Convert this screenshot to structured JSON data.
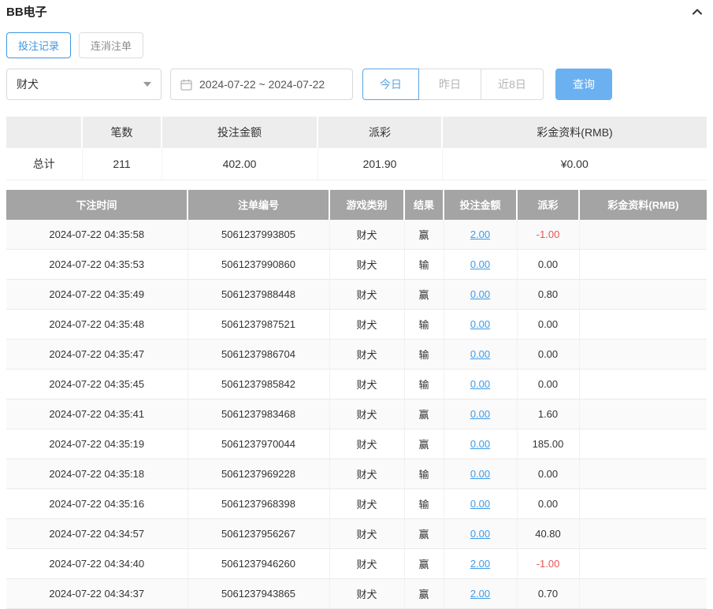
{
  "colors": {
    "accent_blue": "#3d96e0",
    "link_blue": "#3d9ae8",
    "button_blue": "#6bb1f2",
    "negative_red": "#e65454",
    "table_header_gray": "#a4a4a4"
  },
  "header": {
    "title": "BB电子"
  },
  "tabs": [
    {
      "label": "投注记录",
      "active": true
    },
    {
      "label": "连消注单",
      "active": false
    }
  ],
  "filters": {
    "game_select_value": "财犬",
    "date_range_value": "2024-07-22 ~ 2024-07-22",
    "quick_buttons": [
      {
        "label": "今日",
        "active": true
      },
      {
        "label": "昨日",
        "active": false
      },
      {
        "label": "近8日",
        "active": false
      }
    ],
    "search_label": "查询"
  },
  "summary": {
    "headers": [
      "",
      "笔数",
      "投注金额",
      "派彩",
      "彩金资料(RMB)"
    ],
    "row": {
      "label": "总计",
      "count": "211",
      "bet_amount": "402.00",
      "payout": "201.90",
      "bonus": "¥0.00"
    }
  },
  "table": {
    "headers": [
      "下注时间",
      "注单编号",
      "游戏类别",
      "结果",
      "投注金额",
      "派彩",
      "彩金资料(RMB)"
    ],
    "rows": [
      {
        "time": "2024-07-22 04:35:58",
        "order": "5061237993805",
        "game": "财犬",
        "result": "赢",
        "amount": "2.00",
        "payout": "-1.00",
        "bonus": ""
      },
      {
        "time": "2024-07-22 04:35:53",
        "order": "5061237990860",
        "game": "财犬",
        "result": "输",
        "amount": "0.00",
        "payout": "0.00",
        "bonus": ""
      },
      {
        "time": "2024-07-22 04:35:49",
        "order": "5061237988448",
        "game": "财犬",
        "result": "赢",
        "amount": "0.00",
        "payout": "0.80",
        "bonus": ""
      },
      {
        "time": "2024-07-22 04:35:48",
        "order": "5061237987521",
        "game": "财犬",
        "result": "输",
        "amount": "0.00",
        "payout": "0.00",
        "bonus": ""
      },
      {
        "time": "2024-07-22 04:35:47",
        "order": "5061237986704",
        "game": "财犬",
        "result": "输",
        "amount": "0.00",
        "payout": "0.00",
        "bonus": ""
      },
      {
        "time": "2024-07-22 04:35:45",
        "order": "5061237985842",
        "game": "财犬",
        "result": "输",
        "amount": "0.00",
        "payout": "0.00",
        "bonus": ""
      },
      {
        "time": "2024-07-22 04:35:41",
        "order": "5061237983468",
        "game": "财犬",
        "result": "赢",
        "amount": "0.00",
        "payout": "1.60",
        "bonus": ""
      },
      {
        "time": "2024-07-22 04:35:19",
        "order": "5061237970044",
        "game": "财犬",
        "result": "赢",
        "amount": "0.00",
        "payout": "185.00",
        "bonus": ""
      },
      {
        "time": "2024-07-22 04:35:18",
        "order": "5061237969228",
        "game": "财犬",
        "result": "输",
        "amount": "0.00",
        "payout": "0.00",
        "bonus": ""
      },
      {
        "time": "2024-07-22 04:35:16",
        "order": "5061237968398",
        "game": "财犬",
        "result": "输",
        "amount": "0.00",
        "payout": "0.00",
        "bonus": ""
      },
      {
        "time": "2024-07-22 04:34:57",
        "order": "5061237956267",
        "game": "财犬",
        "result": "赢",
        "amount": "0.00",
        "payout": "40.80",
        "bonus": ""
      },
      {
        "time": "2024-07-22 04:34:40",
        "order": "5061237946260",
        "game": "财犬",
        "result": "赢",
        "amount": "2.00",
        "payout": "-1.00",
        "bonus": ""
      },
      {
        "time": "2024-07-22 04:34:37",
        "order": "5061237943865",
        "game": "财犬",
        "result": "赢",
        "amount": "2.00",
        "payout": "0.70",
        "bonus": ""
      }
    ]
  }
}
